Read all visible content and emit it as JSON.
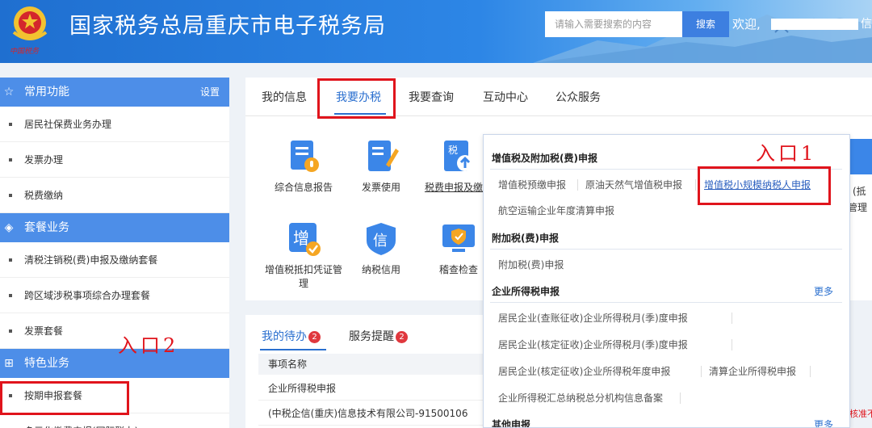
{
  "header": {
    "emblem_text": "中国税务",
    "title": "国家税务总局重庆市电子税务局",
    "search_placeholder": "请输入需要搜索的内容",
    "search_button": "搜索",
    "welcome": "欢迎,",
    "welcome_tail": "信"
  },
  "sidebar": {
    "sections": [
      {
        "title": "常用功能",
        "action": "设置",
        "icon": "star-icon"
      },
      {
        "title": "套餐业务",
        "icon": "layers-icon"
      },
      {
        "title": "特色业务",
        "icon": "grid-icon"
      }
    ],
    "common": [
      "居民社保费业务办理",
      "发票办理",
      "税费缴纳"
    ],
    "packages": [
      "清税注销税(费)申报及缴纳套餐",
      "跨区域涉税事项综合办理套餐",
      "发票套餐"
    ],
    "features": [
      "按期申报套餐"
    ],
    "features_tail": "多元化缴费申报(国际联办)"
  },
  "main_tabs": [
    "我的信息",
    "我要办税",
    "我要查询",
    "互动中心",
    "公众服务"
  ],
  "services": [
    {
      "label": "综合信息报告",
      "icon": "report-icon"
    },
    {
      "label": "发票使用",
      "icon": "invoice-icon"
    },
    {
      "label": "税费申报及缴纳",
      "icon": "tax-declare-icon"
    },
    {
      "label": "增值税抵扣凭证管理",
      "icon": "vat-deduct-icon"
    },
    {
      "label": "纳税信用",
      "icon": "credit-icon"
    },
    {
      "label": "稽查检查",
      "icon": "inspect-icon"
    }
  ],
  "right_fragments": [
    "(抵",
    "管理"
  ],
  "popup": {
    "sec_vat": "增值税及附加税(费)申报",
    "vat_links": [
      "增值税预缴申报",
      "原油天然气增值税申报",
      "增值税小规模纳税人申报",
      "航空运输企业年度清算申报"
    ],
    "sec_surcharge": "附加税(费)申报",
    "surcharge_links": [
      "附加税(费)申报"
    ],
    "sec_cit": "企业所得税申报",
    "more": "更多",
    "cit_links": [
      "居民企业(查账征收)企业所得税月(季)度申报",
      "居民企业(核定征收)企业所得税月(季)度申报",
      "居民企业(核定征收)企业所得税年度申报",
      "清算企业所得税申报",
      "企业所得税汇总纳税总分机构信息备案"
    ],
    "sec_other": "其他申报"
  },
  "todo": {
    "tabs": [
      {
        "label": "我的待办",
        "count": "2"
      },
      {
        "label": "服务提醒",
        "count": "2"
      }
    ],
    "column": "事项名称",
    "rows": [
      "企业所得税申报",
      "(中税企信(重庆)信息技术有限公司-91500106"
    ],
    "side_red": "核准不"
  },
  "annotations": {
    "entry1": "入口1",
    "entry2": "入口2"
  },
  "colors": {
    "accent": "#2a6fcf",
    "sidebar_header": "#4d8ee8",
    "annotation": "#e0141c",
    "badge": "#e0383e"
  }
}
